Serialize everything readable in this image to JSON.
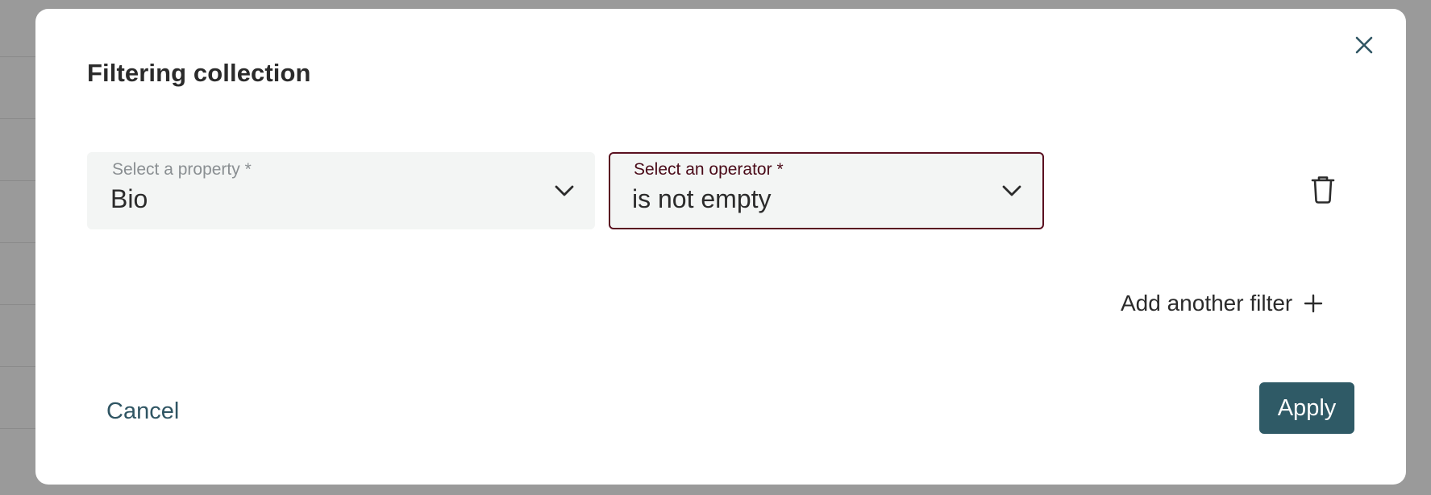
{
  "dialog": {
    "title": "Filtering collection",
    "close_icon": "close-icon"
  },
  "filters": [
    {
      "property": {
        "label": "Select a property *",
        "value": "Bio",
        "icon": "chevron-down-icon"
      },
      "operator": {
        "label": "Select an operator *",
        "value": "is not empty",
        "icon": "chevron-down-icon",
        "border_color": "#5a1020"
      },
      "delete_icon": "trash-icon"
    }
  ],
  "add_filter": {
    "label": "Add another filter",
    "icon": "plus-icon"
  },
  "actions": {
    "cancel_label": "Cancel",
    "apply_label": "Apply",
    "apply_color": "#2f5a66",
    "cancel_color": "#2f5563"
  }
}
